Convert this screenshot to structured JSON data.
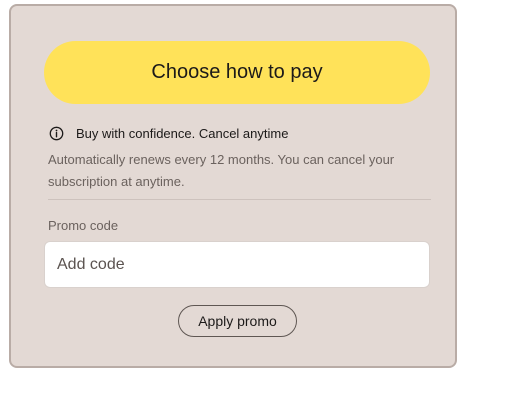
{
  "payment": {
    "pay_button_label": "Choose how to pay"
  },
  "info": {
    "icon": "info-icon",
    "confidence_text": "Buy with confidence. Cancel anytime",
    "renew_text": "Automatically renews every 12 months. You can cancel your subscription at anytime."
  },
  "promo": {
    "label": "Promo code",
    "value": "",
    "placeholder": "Add code",
    "apply_label": "Apply promo"
  },
  "colors": {
    "card_background": "#e3d9d4",
    "card_border": "#b9aca6",
    "pay_button": "#ffe259",
    "text_primary": "#1c1a19",
    "text_secondary": "#6b625e"
  }
}
